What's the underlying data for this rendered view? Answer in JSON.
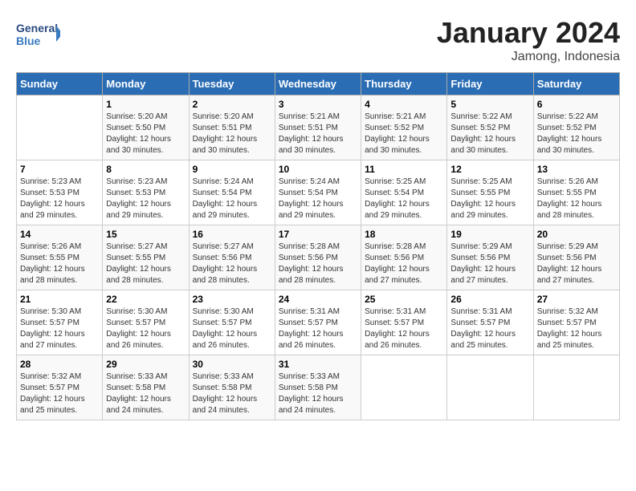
{
  "header": {
    "logo_general": "General",
    "logo_blue": "Blue",
    "month_year": "January 2024",
    "location": "Jamong, Indonesia"
  },
  "weekdays": [
    "Sunday",
    "Monday",
    "Tuesday",
    "Wednesday",
    "Thursday",
    "Friday",
    "Saturday"
  ],
  "weeks": [
    [
      {
        "day": "",
        "info": ""
      },
      {
        "day": "1",
        "info": "Sunrise: 5:20 AM\nSunset: 5:50 PM\nDaylight: 12 hours\nand 30 minutes."
      },
      {
        "day": "2",
        "info": "Sunrise: 5:20 AM\nSunset: 5:51 PM\nDaylight: 12 hours\nand 30 minutes."
      },
      {
        "day": "3",
        "info": "Sunrise: 5:21 AM\nSunset: 5:51 PM\nDaylight: 12 hours\nand 30 minutes."
      },
      {
        "day": "4",
        "info": "Sunrise: 5:21 AM\nSunset: 5:52 PM\nDaylight: 12 hours\nand 30 minutes."
      },
      {
        "day": "5",
        "info": "Sunrise: 5:22 AM\nSunset: 5:52 PM\nDaylight: 12 hours\nand 30 minutes."
      },
      {
        "day": "6",
        "info": "Sunrise: 5:22 AM\nSunset: 5:52 PM\nDaylight: 12 hours\nand 30 minutes."
      }
    ],
    [
      {
        "day": "7",
        "info": "Sunrise: 5:23 AM\nSunset: 5:53 PM\nDaylight: 12 hours\nand 29 minutes."
      },
      {
        "day": "8",
        "info": "Sunrise: 5:23 AM\nSunset: 5:53 PM\nDaylight: 12 hours\nand 29 minutes."
      },
      {
        "day": "9",
        "info": "Sunrise: 5:24 AM\nSunset: 5:54 PM\nDaylight: 12 hours\nand 29 minutes."
      },
      {
        "day": "10",
        "info": "Sunrise: 5:24 AM\nSunset: 5:54 PM\nDaylight: 12 hours\nand 29 minutes."
      },
      {
        "day": "11",
        "info": "Sunrise: 5:25 AM\nSunset: 5:54 PM\nDaylight: 12 hours\nand 29 minutes."
      },
      {
        "day": "12",
        "info": "Sunrise: 5:25 AM\nSunset: 5:55 PM\nDaylight: 12 hours\nand 29 minutes."
      },
      {
        "day": "13",
        "info": "Sunrise: 5:26 AM\nSunset: 5:55 PM\nDaylight: 12 hours\nand 28 minutes."
      }
    ],
    [
      {
        "day": "14",
        "info": "Sunrise: 5:26 AM\nSunset: 5:55 PM\nDaylight: 12 hours\nand 28 minutes."
      },
      {
        "day": "15",
        "info": "Sunrise: 5:27 AM\nSunset: 5:55 PM\nDaylight: 12 hours\nand 28 minutes."
      },
      {
        "day": "16",
        "info": "Sunrise: 5:27 AM\nSunset: 5:56 PM\nDaylight: 12 hours\nand 28 minutes."
      },
      {
        "day": "17",
        "info": "Sunrise: 5:28 AM\nSunset: 5:56 PM\nDaylight: 12 hours\nand 28 minutes."
      },
      {
        "day": "18",
        "info": "Sunrise: 5:28 AM\nSunset: 5:56 PM\nDaylight: 12 hours\nand 27 minutes."
      },
      {
        "day": "19",
        "info": "Sunrise: 5:29 AM\nSunset: 5:56 PM\nDaylight: 12 hours\nand 27 minutes."
      },
      {
        "day": "20",
        "info": "Sunrise: 5:29 AM\nSunset: 5:56 PM\nDaylight: 12 hours\nand 27 minutes."
      }
    ],
    [
      {
        "day": "21",
        "info": "Sunrise: 5:30 AM\nSunset: 5:57 PM\nDaylight: 12 hours\nand 27 minutes."
      },
      {
        "day": "22",
        "info": "Sunrise: 5:30 AM\nSunset: 5:57 PM\nDaylight: 12 hours\nand 26 minutes."
      },
      {
        "day": "23",
        "info": "Sunrise: 5:30 AM\nSunset: 5:57 PM\nDaylight: 12 hours\nand 26 minutes."
      },
      {
        "day": "24",
        "info": "Sunrise: 5:31 AM\nSunset: 5:57 PM\nDaylight: 12 hours\nand 26 minutes."
      },
      {
        "day": "25",
        "info": "Sunrise: 5:31 AM\nSunset: 5:57 PM\nDaylight: 12 hours\nand 26 minutes."
      },
      {
        "day": "26",
        "info": "Sunrise: 5:31 AM\nSunset: 5:57 PM\nDaylight: 12 hours\nand 25 minutes."
      },
      {
        "day": "27",
        "info": "Sunrise: 5:32 AM\nSunset: 5:57 PM\nDaylight: 12 hours\nand 25 minutes."
      }
    ],
    [
      {
        "day": "28",
        "info": "Sunrise: 5:32 AM\nSunset: 5:57 PM\nDaylight: 12 hours\nand 25 minutes."
      },
      {
        "day": "29",
        "info": "Sunrise: 5:33 AM\nSunset: 5:58 PM\nDaylight: 12 hours\nand 24 minutes."
      },
      {
        "day": "30",
        "info": "Sunrise: 5:33 AM\nSunset: 5:58 PM\nDaylight: 12 hours\nand 24 minutes."
      },
      {
        "day": "31",
        "info": "Sunrise: 5:33 AM\nSunset: 5:58 PM\nDaylight: 12 hours\nand 24 minutes."
      },
      {
        "day": "",
        "info": ""
      },
      {
        "day": "",
        "info": ""
      },
      {
        "day": "",
        "info": ""
      }
    ]
  ]
}
